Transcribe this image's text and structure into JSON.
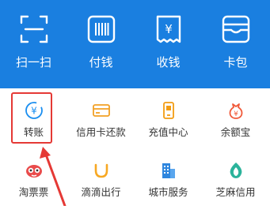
{
  "top_actions": [
    {
      "label": "扫一扫",
      "icon": "scan-icon"
    },
    {
      "label": "付钱",
      "icon": "barcode-icon"
    },
    {
      "label": "收钱",
      "icon": "receive-money-icon"
    },
    {
      "label": "卡包",
      "icon": "card-wallet-icon"
    }
  ],
  "services_row1": [
    {
      "label": "转账",
      "icon": "transfer-icon",
      "color": "#1a8ef0"
    },
    {
      "label": "信用卡还款",
      "icon": "credit-card-icon",
      "color": "#f2a024"
    },
    {
      "label": "充值中心",
      "icon": "phone-topup-icon",
      "color": "#f39c12"
    },
    {
      "label": "余额宝",
      "icon": "yuebao-icon",
      "color": "#f05a3a"
    }
  ],
  "services_row2": [
    {
      "label": "淘票票",
      "icon": "taopiaopiao-icon",
      "color": "#e94b4b"
    },
    {
      "label": "滴滴出行",
      "icon": "didi-icon",
      "color": "#f7a823"
    },
    {
      "label": "城市服务",
      "icon": "city-service-icon",
      "color": "#2e86de"
    },
    {
      "label": "芝麻信用",
      "icon": "sesame-credit-icon",
      "color": "#2bb39b"
    }
  ],
  "colors": {
    "top_bar": "#1a7fe0",
    "highlight": "#e53935"
  }
}
